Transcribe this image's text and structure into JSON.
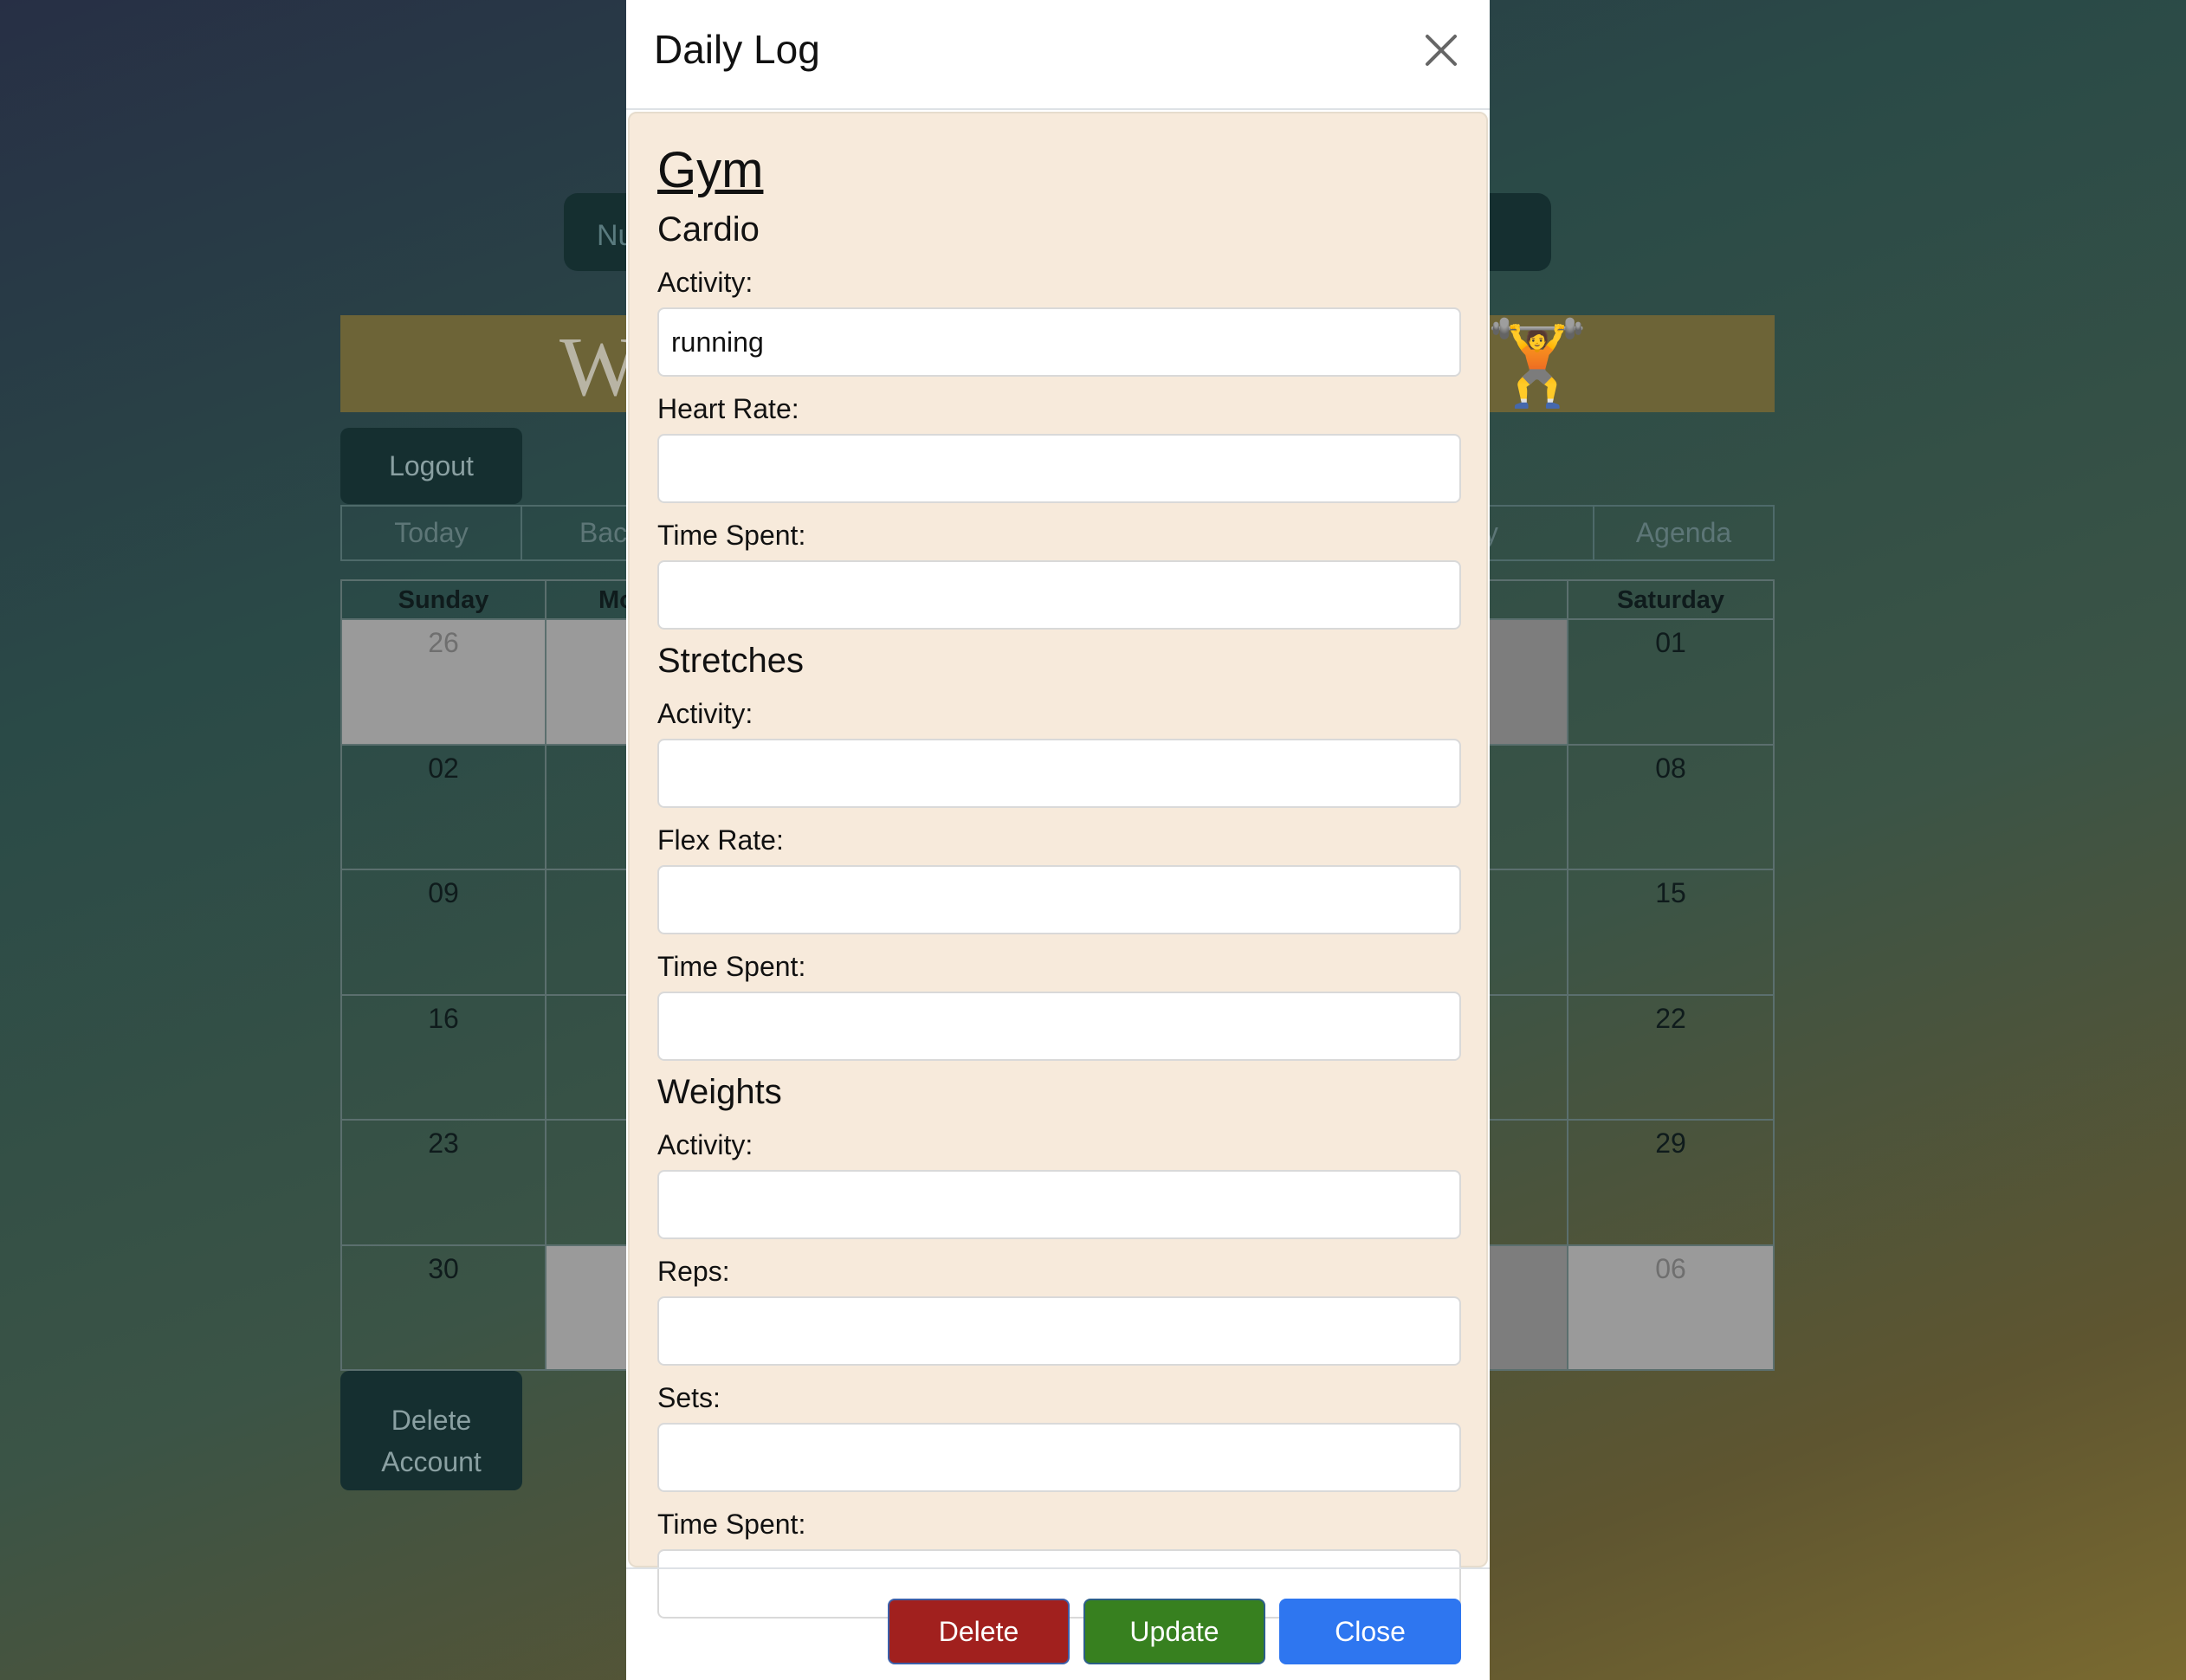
{
  "background": {
    "nav_partial_text": "Nu",
    "banner_partial_text": "W",
    "banner_emoji": "🏋️",
    "logout_label": "Logout",
    "delete_account_label": "Delete Account",
    "toolbar": [
      "Today",
      "Bac",
      "",
      "",
      "",
      "Day",
      "Agenda"
    ],
    "calendar": {
      "days": [
        "Sunday",
        "Mo",
        "",
        "",
        "",
        "y",
        "Saturday"
      ],
      "weeks": [
        [
          "26",
          "",
          "",
          "",
          "",
          "",
          "01"
        ],
        [
          "02",
          "",
          "",
          "",
          "",
          "",
          "08"
        ],
        [
          "09",
          "",
          "",
          "",
          "",
          "",
          "15"
        ],
        [
          "16",
          "",
          "",
          "",
          "",
          "",
          "22"
        ],
        [
          "23",
          "",
          "",
          "",
          "",
          "",
          "29"
        ],
        [
          "30",
          "",
          "",
          "",
          "",
          "",
          "06"
        ]
      ]
    }
  },
  "modal": {
    "title": "Daily Log",
    "section": "Gym",
    "cardio": {
      "title": "Cardio",
      "activity_label": "Activity:",
      "activity_value": "running",
      "heart_rate_label": "Heart Rate:",
      "heart_rate_value": "",
      "time_label": "Time Spent:",
      "time_value": ""
    },
    "stretches": {
      "title": "Stretches",
      "activity_label": "Activity:",
      "activity_value": "",
      "flex_rate_label": "Flex Rate:",
      "flex_rate_value": "",
      "time_label": "Time Spent:",
      "time_value": ""
    },
    "weights": {
      "title": "Weights",
      "activity_label": "Activity:",
      "activity_value": "",
      "reps_label": "Reps:",
      "reps_value": "",
      "sets_label": "Sets:",
      "sets_value": "",
      "time_label": "Time Spent:",
      "time_value": ""
    },
    "footer": {
      "delete_label": "Delete",
      "update_label": "Update",
      "close_label": "Close"
    }
  },
  "colors": {
    "modal_body_bg": "#f7eadb",
    "delete": "#a1201e",
    "update": "#37801f",
    "close": "#2e76f0"
  }
}
